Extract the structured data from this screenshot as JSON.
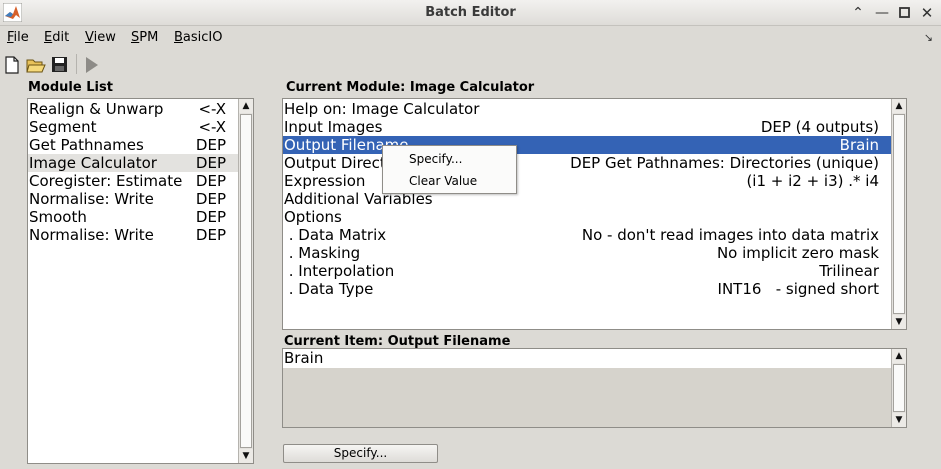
{
  "window": {
    "title": "Batch Editor"
  },
  "menubar": [
    {
      "label": "File",
      "key": "F",
      "rest": "ile"
    },
    {
      "label": "Edit",
      "key": "E",
      "rest": "dit"
    },
    {
      "label": "View",
      "key": "V",
      "rest": "iew"
    },
    {
      "label": "SPM",
      "key": "S",
      "rest": "PM"
    },
    {
      "label": "BasicIO",
      "key": "B",
      "rest": "asicIO"
    }
  ],
  "module_list": {
    "label": "Module List",
    "selected_index": 3,
    "items": [
      {
        "name": "Realign & Unwarp",
        "status": "<-X"
      },
      {
        "name": "Segment",
        "status": "<-X"
      },
      {
        "name": "Get Pathnames",
        "status": "DEP"
      },
      {
        "name": "Image Calculator",
        "status": "DEP"
      },
      {
        "name": "Coregister: Estimate",
        "status": "DEP"
      },
      {
        "name": "Normalise: Write",
        "status": "DEP"
      },
      {
        "name": "Smooth",
        "status": "DEP"
      },
      {
        "name": "Normalise: Write",
        "status": "DEP"
      }
    ]
  },
  "current_module": {
    "label": "Current Module: Image Calculator",
    "selected_index": 2,
    "rows": [
      {
        "name": "Help on: Image Calculator",
        "value": ""
      },
      {
        "name": "Input Images",
        "value": "DEP (4 outputs)"
      },
      {
        "name": "Output Filename",
        "value": "Brain"
      },
      {
        "name": "Output Directory",
        "value": "DEP Get Pathnames: Directories (unique)"
      },
      {
        "name": "Expression",
        "value": "(i1 + i2 + i3) .* i4"
      },
      {
        "name": "Additional Variables",
        "value": ""
      },
      {
        "name": "Options",
        "value": ""
      },
      {
        "name": " . Data Matrix",
        "value": "No - don't read images into data matrix"
      },
      {
        "name": " . Masking",
        "value": "No implicit zero mask"
      },
      {
        "name": " . Interpolation",
        "value": "Trilinear"
      },
      {
        "name": " . Data Type",
        "value": "INT16   - signed short"
      }
    ]
  },
  "context_menu": {
    "items": [
      "Specify...",
      "Clear Value"
    ]
  },
  "current_item": {
    "label": "Current Item: Output Filename",
    "value": "Brain"
  },
  "specify_button": {
    "label": "Specify..."
  },
  "colors": {
    "selection": "#3463b5",
    "background": "#dcdad5"
  }
}
